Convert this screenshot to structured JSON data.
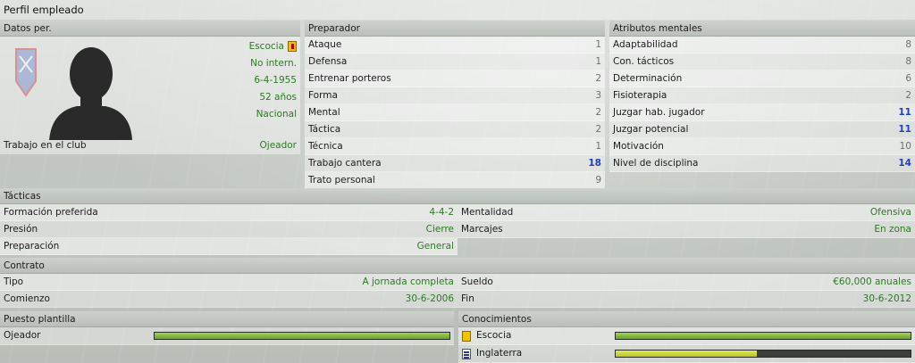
{
  "window": {
    "title": "Perfil empleado"
  },
  "personal": {
    "header": "Datos per.",
    "nationality": "Escocia",
    "international": "No intern.",
    "birth_date": "6-4-1955",
    "age": "52 años",
    "reputation": "Nacional",
    "job_label": "Trabajo en el club",
    "job_value": "Ojeador"
  },
  "coach": {
    "header": "Preparador",
    "rows": [
      {
        "label": "Ataque",
        "value": "1",
        "hi": false
      },
      {
        "label": "Defensa",
        "value": "1",
        "hi": false
      },
      {
        "label": "Entrenar porteros",
        "value": "2",
        "hi": false
      },
      {
        "label": "Forma",
        "value": "3",
        "hi": false
      },
      {
        "label": "Mental",
        "value": "2",
        "hi": false
      },
      {
        "label": "Táctica",
        "value": "2",
        "hi": false
      },
      {
        "label": "Técnica",
        "value": "1",
        "hi": false
      },
      {
        "label": "Trabajo cantera",
        "value": "18",
        "hi": true
      },
      {
        "label": "Trato personal",
        "value": "9",
        "hi": false
      }
    ]
  },
  "mental": {
    "header": "Atributos mentales",
    "rows": [
      {
        "label": "Adaptabilidad",
        "value": "8",
        "hi": false
      },
      {
        "label": "Con. tácticos",
        "value": "8",
        "hi": false
      },
      {
        "label": "Determinación",
        "value": "6",
        "hi": false
      },
      {
        "label": "Fisioterapia",
        "value": "2",
        "hi": false
      },
      {
        "label": "Juzgar hab. jugador",
        "value": "11",
        "hi": true
      },
      {
        "label": "Juzgar potencial",
        "value": "11",
        "hi": true
      },
      {
        "label": "Motivación",
        "value": "10",
        "hi": false
      },
      {
        "label": "Nivel de disciplina",
        "value": "14",
        "hi": true
      }
    ]
  },
  "tactics": {
    "header": "Tácticas",
    "formation_label": "Formación preferida",
    "formation_value": "4-4-2",
    "mentality_label": "Mentalidad",
    "mentality_value": "Ofensiva",
    "pressing_label": "Presión",
    "pressing_value": "Cierre",
    "marking_label": "Marcajes",
    "marking_value": "En zona",
    "prep_label": "Preparación",
    "prep_value": "General"
  },
  "contract": {
    "header": "Contrato",
    "type_label": "Tipo",
    "type_value": "A jornada completa",
    "wage_label": "Sueldo",
    "wage_value": "€60,000 anuales",
    "start_label": "Comienzo",
    "start_value": "30-6-2006",
    "end_label": "Fin",
    "end_value": "30-6-2012"
  },
  "squad": {
    "header": "Puesto plantilla",
    "role_label": "Ojeador",
    "role_level": 1.0
  },
  "knowledge": {
    "header": "Conocimientos",
    "items": [
      {
        "name": "Escocia",
        "level": 1.0,
        "icon": "scotland-flag-icon"
      },
      {
        "name": "Inglaterra",
        "level": 0.48,
        "icon": "england-flag-icon"
      }
    ]
  },
  "colors": {
    "green_text": "#2c7a22",
    "highlight_value": "#1f3fbf",
    "bar_green": "#8cc242",
    "bar_yellow": "#cfd63a"
  }
}
